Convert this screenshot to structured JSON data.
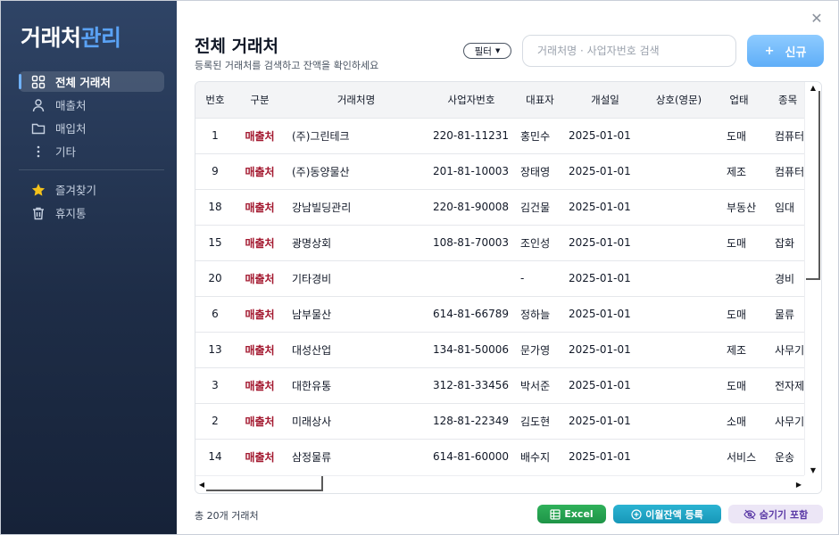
{
  "app": {
    "logo_part1": "거래처",
    "logo_part2": "관리"
  },
  "sidebar": {
    "items": [
      {
        "label": "전체 거래처",
        "icon": "grid-icon",
        "active": true
      },
      {
        "label": "매출처",
        "icon": "user-icon",
        "active": false
      },
      {
        "label": "매입처",
        "icon": "folder-icon",
        "active": false
      },
      {
        "label": "기타",
        "icon": "more-vertical-icon",
        "active": false
      }
    ],
    "secondary": [
      {
        "label": "즐겨찾기",
        "icon": "star-icon"
      },
      {
        "label": "휴지통",
        "icon": "trash-icon"
      }
    ]
  },
  "header": {
    "title": "전체 거래처",
    "subtitle": "등록된 거래처를 검색하고 잔액을 확인하세요",
    "filter_label": "필터",
    "search_placeholder": "거래처명 · 사업자번호 검색",
    "new_button_label": "신규"
  },
  "table": {
    "columns": [
      "번호",
      "구분",
      "거래처명",
      "사업자번호",
      "대표자",
      "개설일",
      "상호(영문)",
      "업태",
      "종목"
    ],
    "rows": [
      {
        "no": "1",
        "type": "매출처",
        "name": "(주)그린테크",
        "biz_no": "220-81-11231",
        "rep": "홍민수",
        "opened": "2025-01-01",
        "eng": "",
        "industry": "도매",
        "item": "컴퓨터"
      },
      {
        "no": "9",
        "type": "매출처",
        "name": "(주)동양물산",
        "biz_no": "201-81-10003",
        "rep": "장태영",
        "opened": "2025-01-01",
        "eng": "",
        "industry": "제조",
        "item": "컴퓨터주"
      },
      {
        "no": "18",
        "type": "매출처",
        "name": "강남빌딩관리",
        "biz_no": "220-81-90008",
        "rep": "김건물",
        "opened": "2025-01-01",
        "eng": "",
        "industry": "부동산",
        "item": "임대"
      },
      {
        "no": "15",
        "type": "매출처",
        "name": "광명상회",
        "biz_no": "108-81-70003",
        "rep": "조인성",
        "opened": "2025-01-01",
        "eng": "",
        "industry": "도매",
        "item": "잡화"
      },
      {
        "no": "20",
        "type": "매출처",
        "name": "기타경비",
        "biz_no": "",
        "rep": "-",
        "opened": "2025-01-01",
        "eng": "",
        "industry": "",
        "item": "경비"
      },
      {
        "no": "6",
        "type": "매출처",
        "name": "남부물산",
        "biz_no": "614-81-66789",
        "rep": "정하늘",
        "opened": "2025-01-01",
        "eng": "",
        "industry": "도매",
        "item": "물류"
      },
      {
        "no": "13",
        "type": "매출처",
        "name": "대성산업",
        "biz_no": "134-81-50006",
        "rep": "문가영",
        "opened": "2025-01-01",
        "eng": "",
        "industry": "제조",
        "item": "사무기기"
      },
      {
        "no": "3",
        "type": "매출처",
        "name": "대한유통",
        "biz_no": "312-81-33456",
        "rep": "박서준",
        "opened": "2025-01-01",
        "eng": "",
        "industry": "도매",
        "item": "전자제품"
      },
      {
        "no": "2",
        "type": "매출처",
        "name": "미래상사",
        "biz_no": "128-81-22349",
        "rep": "김도현",
        "opened": "2025-01-01",
        "eng": "",
        "industry": "소매",
        "item": "사무기기"
      },
      {
        "no": "14",
        "type": "매출처",
        "name": "삼정물류",
        "biz_no": "614-81-60000",
        "rep": "배수지",
        "opened": "2025-01-01",
        "eng": "",
        "industry": "서비스",
        "item": "운송"
      }
    ]
  },
  "footer": {
    "total_label": "총 20개 거래처",
    "excel_label": "Excel",
    "balance_label": "이월잔액 등록",
    "hidden_label": "숨기기 포함"
  },
  "colors": {
    "sidebar_top": "#2f4466",
    "sidebar_bottom": "#162238",
    "accent_blue": "#5faef8",
    "type_red": "#a3182f",
    "excel_green": "#1e9447",
    "balance_teal": "#1797b8",
    "hidden_purple": "#5b3aa6"
  }
}
